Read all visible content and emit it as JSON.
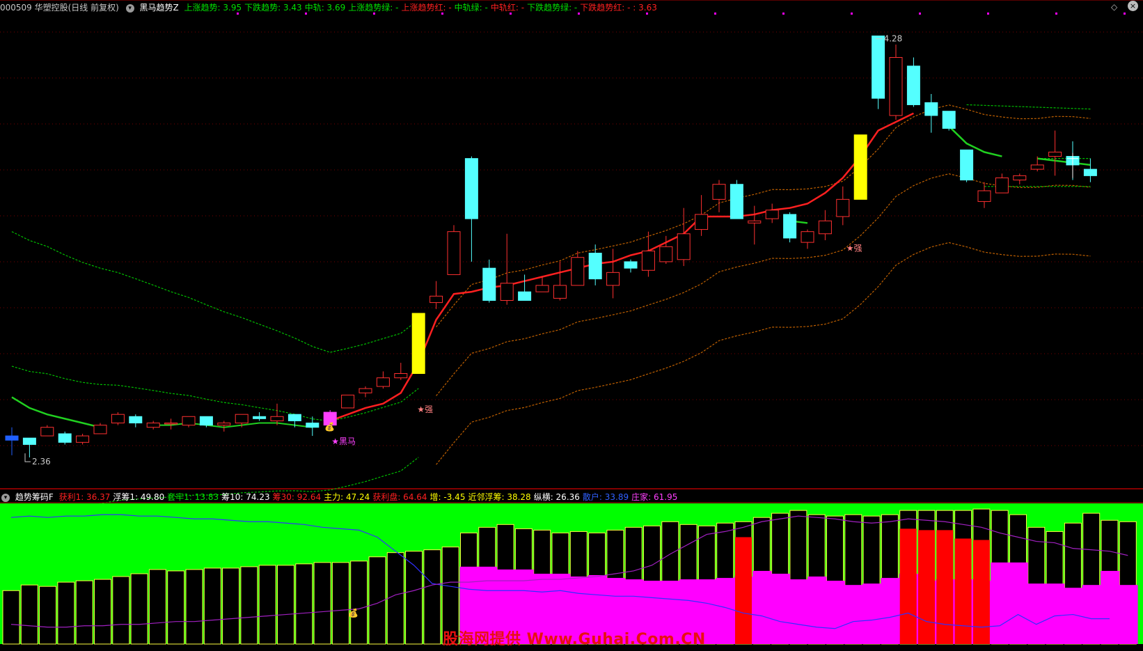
{
  "header_top": {
    "stock": "000509 华塑控股(日线 前复权)",
    "indicator": "黑马趋势Z",
    "items": [
      {
        "label": "上涨趋势: 3.95",
        "color": "#00e000"
      },
      {
        "label": "下跌趋势: 3.43",
        "color": "#00e000"
      },
      {
        "label": "中轨: 3.69",
        "color": "#00e000"
      },
      {
        "label": "上涨趋势绿: -",
        "color": "#00e000"
      },
      {
        "label": "上涨趋势红: -",
        "color": "#ff2020"
      },
      {
        "label": "中轨绿: -",
        "color": "#00e000"
      },
      {
        "label": "中轨红: -",
        "color": "#ff2020"
      },
      {
        "label": "下跌趋势绿: -",
        "color": "#00e000"
      },
      {
        "label": "下跌趋势红: - : 3.63",
        "color": "#ff2020"
      }
    ]
  },
  "header_bottom": {
    "indicator": "趋势筹码F",
    "items": [
      {
        "label": "获利1: 36.37",
        "color": "#ff2020"
      },
      {
        "label": "浮筹1: 49.80",
        "color": "#ffffff"
      },
      {
        "label": "套牢1: 13.83",
        "color": "#00e000"
      },
      {
        "label": "筹10: 74.23",
        "color": "#ffffff"
      },
      {
        "label": "筹30: 92.64",
        "color": "#ff2020"
      },
      {
        "label": "主力: 47.24",
        "color": "#ffff00"
      },
      {
        "label": "获利盘: 64.64",
        "color": "#ff2020"
      },
      {
        "label": "增: -3.45",
        "color": "#ffff00"
      },
      {
        "label": "近邻浮筹: 38.28",
        "color": "#ffff00"
      },
      {
        "label": "纵横: 26.36",
        "color": "#ffffff"
      },
      {
        "label": "散户: 33.89",
        "color": "#3060ff"
      },
      {
        "label": "庄家: 61.95",
        "color": "#ff40ff"
      }
    ]
  },
  "annotations": {
    "high_label": "4.28",
    "low_label": "2.36",
    "heima_label": "★黑马",
    "strong_label": "★强",
    "money_icon": "💰"
  },
  "watermark": "股海网提供 Www.Guhai.Com.CN",
  "chart_data": {
    "type": "candlestick",
    "price_range": [
      2.2,
      4.35
    ],
    "candles": [
      [
        2.4,
        2.42,
        2.46,
        2.33
      ],
      [
        2.41,
        2.38,
        2.38,
        2.32
      ],
      [
        2.42,
        2.46,
        2.47,
        2.42
      ],
      [
        2.43,
        2.39,
        2.44,
        2.38
      ],
      [
        2.39,
        2.42,
        2.43,
        2.38
      ],
      [
        2.43,
        2.47,
        2.48,
        2.43
      ],
      [
        2.48,
        2.52,
        2.53,
        2.47
      ],
      [
        2.51,
        2.48,
        2.52,
        2.46
      ],
      [
        2.46,
        2.48,
        2.49,
        2.45
      ],
      [
        2.48,
        2.48,
        2.5,
        2.45
      ],
      [
        2.47,
        2.51,
        2.51,
        2.46
      ],
      [
        2.51,
        2.47,
        2.51,
        2.46
      ],
      [
        2.47,
        2.48,
        2.49,
        2.44
      ],
      [
        2.48,
        2.52,
        2.52,
        2.46
      ],
      [
        2.51,
        2.5,
        2.53,
        2.49
      ],
      [
        2.49,
        2.51,
        2.57,
        2.47
      ],
      [
        2.52,
        2.49,
        2.52,
        2.46
      ],
      [
        2.48,
        2.46,
        2.51,
        2.42
      ],
      [
        2.47,
        2.53,
        2.54,
        2.47
      ],
      [
        2.55,
        2.61,
        2.61,
        2.55
      ],
      [
        2.62,
        2.64,
        2.65,
        2.6
      ],
      [
        2.65,
        2.69,
        2.72,
        2.64
      ],
      [
        2.69,
        2.71,
        2.76,
        2.68
      ],
      [
        2.71,
        2.99,
        2.99,
        2.71
      ],
      [
        3.04,
        3.07,
        3.14,
        3.01
      ],
      [
        3.17,
        3.37,
        3.4,
        3.17
      ],
      [
        3.71,
        3.43,
        3.72,
        3.23
      ],
      [
        3.2,
        3.05,
        3.24,
        3.04
      ],
      [
        3.05,
        3.13,
        3.36,
        3.03
      ],
      [
        3.09,
        3.05,
        3.17,
        3.05
      ],
      [
        3.09,
        3.12,
        3.16,
        3.11
      ],
      [
        3.06,
        3.12,
        3.23,
        3.05
      ],
      [
        3.12,
        3.25,
        3.28,
        3.12
      ],
      [
        3.27,
        3.15,
        3.31,
        3.12
      ],
      [
        3.12,
        3.18,
        3.29,
        3.06
      ],
      [
        3.23,
        3.2,
        3.24,
        3.18
      ],
      [
        3.19,
        3.28,
        3.37,
        3.16
      ],
      [
        3.23,
        3.3,
        3.35,
        3.22
      ],
      [
        3.24,
        3.36,
        3.48,
        3.21
      ],
      [
        3.38,
        3.45,
        3.54,
        3.35
      ],
      [
        3.52,
        3.59,
        3.61,
        3.46
      ],
      [
        3.59,
        3.43,
        3.61,
        3.43
      ],
      [
        3.41,
        3.42,
        3.49,
        3.31
      ],
      [
        3.43,
        3.47,
        3.5,
        3.41
      ],
      [
        3.45,
        3.34,
        3.46,
        3.32
      ],
      [
        3.32,
        3.37,
        3.38,
        3.29
      ],
      [
        3.36,
        3.42,
        3.47,
        3.33
      ],
      [
        3.44,
        3.52,
        3.58,
        3.4
      ],
      [
        3.52,
        3.82,
        3.82,
        3.52
      ],
      [
        4.28,
        3.99,
        4.28,
        3.94
      ],
      [
        3.91,
        4.18,
        4.24,
        3.89
      ],
      [
        4.14,
        3.96,
        4.18,
        3.95
      ],
      [
        3.97,
        3.91,
        4.01,
        3.83
      ],
      [
        3.93,
        3.85,
        3.93,
        3.84
      ],
      [
        3.75,
        3.61,
        3.74,
        3.6
      ],
      [
        3.51,
        3.56,
        3.6,
        3.48
      ],
      [
        3.55,
        3.62,
        3.64,
        3.56
      ],
      [
        3.61,
        3.63,
        3.64,
        3.59
      ],
      [
        3.66,
        3.68,
        3.72,
        3.65
      ],
      [
        3.72,
        3.74,
        3.84,
        3.63
      ],
      [
        3.72,
        3.68,
        3.79,
        3.61
      ],
      [
        3.66,
        3.63,
        3.71,
        3.6
      ]
    ],
    "overlay_lines": [
      {
        "name": "上涨趋势",
        "color": "#00e000",
        "style": "dashed"
      },
      {
        "name": "中轨",
        "color": "#00e000",
        "style": "dashed"
      },
      {
        "name": "下跌趋势",
        "color": "#00e000",
        "style": "dashed"
      }
    ],
    "sub_chart": {
      "type": "bar",
      "range": [
        0,
        100
      ],
      "black_bars": [
        38,
        42,
        41,
        44,
        45,
        46,
        48,
        50,
        53,
        52,
        53,
        54,
        54,
        55,
        56,
        56,
        57,
        58,
        58,
        59,
        62,
        65,
        66,
        67,
        69,
        79,
        83,
        85,
        82,
        81,
        79,
        80,
        79,
        81,
        83,
        84,
        87,
        85,
        84,
        86,
        87,
        90,
        93,
        95,
        92,
        91,
        92,
        91,
        92,
        95,
        95,
        95,
        95,
        96,
        95,
        92,
        83,
        80,
        86,
        93,
        88,
        87
      ],
      "magenta_bars": [
        0,
        0,
        0,
        0,
        0,
        0,
        0,
        0,
        0,
        0,
        0,
        0,
        0,
        0,
        0,
        0,
        0,
        0,
        0,
        0,
        0,
        0,
        0,
        0,
        0,
        55,
        55,
        53,
        53,
        50,
        50,
        48,
        49,
        47,
        46,
        45,
        45,
        46,
        46,
        47,
        48,
        52,
        50,
        46,
        48,
        45,
        42,
        43,
        47,
        50,
        45,
        46,
        46,
        45,
        58,
        58,
        43,
        43,
        40,
        42,
        52,
        42
      ],
      "red_bars": [
        0,
        0,
        0,
        0,
        0,
        0,
        0,
        0,
        0,
        0,
        0,
        0,
        0,
        0,
        0,
        0,
        0,
        0,
        0,
        0,
        0,
        0,
        0,
        0,
        0,
        0,
        0,
        0,
        0,
        0,
        0,
        0,
        0,
        0,
        0,
        0,
        0,
        0,
        0,
        0,
        76,
        0,
        0,
        0,
        0,
        0,
        0,
        0,
        0,
        82,
        81,
        81,
        75,
        74,
        0,
        0,
        0,
        0,
        0,
        0,
        0,
        0
      ],
      "blue_line": [
        90,
        91,
        90,
        91,
        91,
        92,
        92,
        91,
        91,
        90,
        89,
        89,
        88,
        87,
        87,
        86,
        85,
        83,
        82,
        81,
        76,
        66,
        56,
        43,
        41,
        39,
        38,
        38,
        38,
        37,
        38,
        36,
        35,
        34,
        34,
        33,
        32,
        31,
        29,
        26,
        22,
        20,
        16,
        14,
        12,
        11,
        16,
        17,
        19,
        22,
        16,
        14,
        13,
        12,
        13,
        21,
        14,
        20,
        21,
        18,
        18
      ],
      "purple_line": [
        14,
        13,
        12,
        12,
        13,
        13,
        14,
        14,
        15,
        16,
        16,
        17,
        18,
        19,
        20,
        21,
        22,
        23,
        24,
        25,
        29,
        35,
        38,
        42,
        44,
        44,
        45,
        45,
        45,
        46,
        46,
        47,
        48,
        50,
        52,
        56,
        64,
        71,
        78,
        80,
        83,
        87,
        89,
        91,
        90,
        89,
        87,
        86,
        87,
        89,
        88,
        87,
        85,
        83,
        79,
        76,
        73,
        72,
        68,
        67,
        66,
        63
      ]
    }
  }
}
